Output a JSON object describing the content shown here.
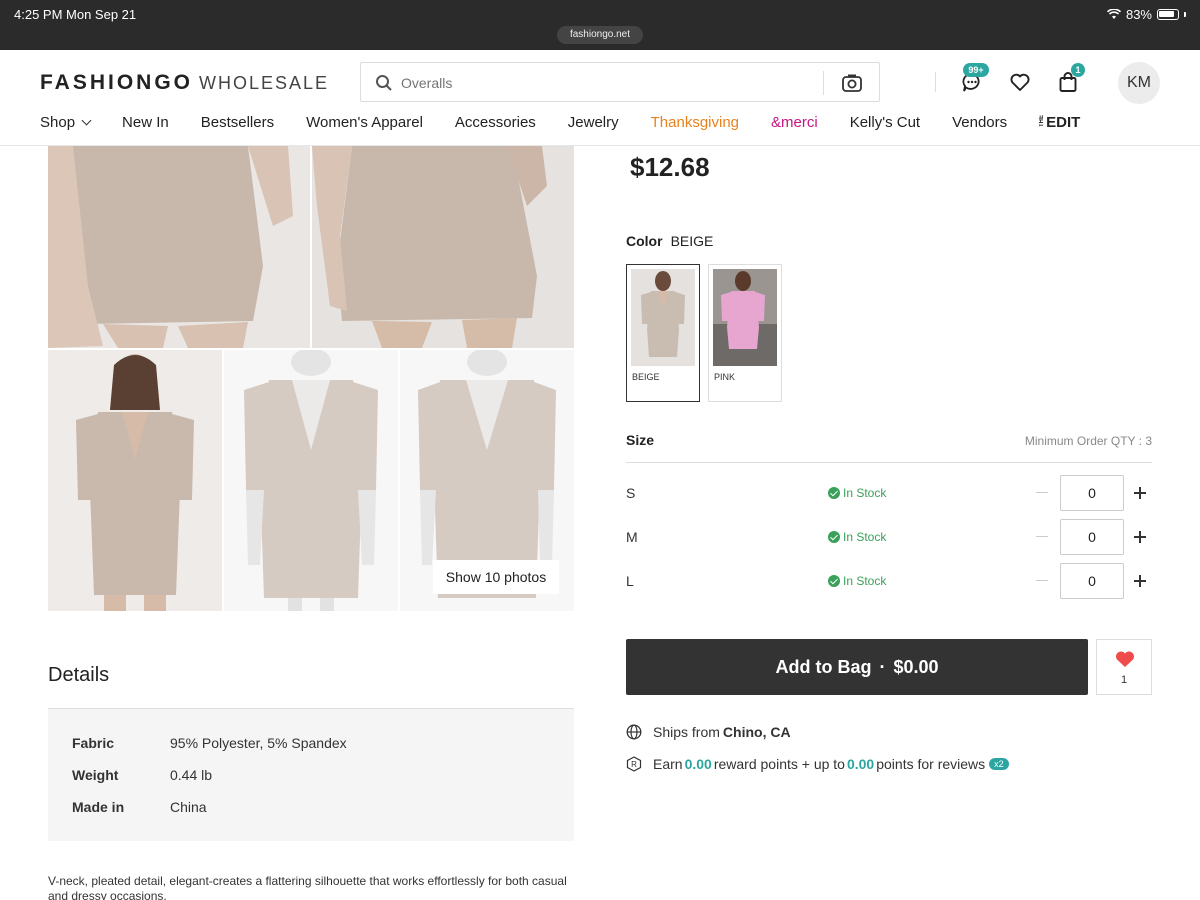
{
  "status_bar": {
    "time": "4:25 PM  Mon Sep 21",
    "url": "fashiongo.net",
    "battery": "83%"
  },
  "header": {
    "logo_main": "FASHIONGO",
    "logo_sub": "WHOLESALE",
    "search_placeholder": "Overalls",
    "messages_badge": "99+",
    "cart_badge": "1",
    "avatar_initials": "KM"
  },
  "nav": {
    "items": [
      "Shop",
      "New In",
      "Bestsellers",
      "Women's Apparel",
      "Accessories",
      "Jewelry",
      "Thanksgiving",
      "&merci",
      "Kelly's Cut",
      "Vendors",
      "EDIT"
    ],
    "edit_prefix": "THE",
    "colors": {
      "thanksgiving": "#e8821c",
      "merci": "#c71585"
    }
  },
  "gallery": {
    "show_photos_label": "Show 10 photos"
  },
  "details": {
    "title": "Details",
    "rows": [
      {
        "key": "Fabric",
        "value": "95% Polyester, 5% Spandex"
      },
      {
        "key": "Weight",
        "value": "0.44 lb"
      },
      {
        "key": "Made in",
        "value": "China"
      }
    ],
    "description": "V-neck, pleated detail, elegant-creates a flattering silhouette that works effortlessly for both casual and dressy occasions."
  },
  "product": {
    "price": "$12.68",
    "color_label": "Color",
    "color_value": "BEIGE",
    "swatches": [
      {
        "label": "BEIGE",
        "selected": true,
        "color": "#c9bcb0"
      },
      {
        "label": "PINK",
        "selected": false,
        "color": "#e7a6cf"
      }
    ],
    "size_label": "Size",
    "min_qty": "Minimum Order QTY : 3",
    "sizes": [
      {
        "size": "S",
        "stock": "In Stock",
        "qty": "0"
      },
      {
        "size": "M",
        "stock": "In Stock",
        "qty": "0"
      },
      {
        "size": "L",
        "stock": "In Stock",
        "qty": "0"
      }
    ],
    "add_to_bag_label": "Add to Bag",
    "add_to_bag_total": "$0.00",
    "favorite_count": "1",
    "ships_from_label": "Ships from",
    "ships_from_value": "Chino, CA",
    "earn_prefix": "Earn",
    "earn_points": "0.00",
    "earn_mid": "reward points + up to",
    "review_points": "0.00",
    "earn_suffix": "points for reviews",
    "multiplier": "x2"
  },
  "colors": {
    "teal": "#2ba6a0",
    "dark_button": "#333333",
    "in_stock_green": "#3aa05a",
    "heart_red": "#ef4b4b"
  }
}
